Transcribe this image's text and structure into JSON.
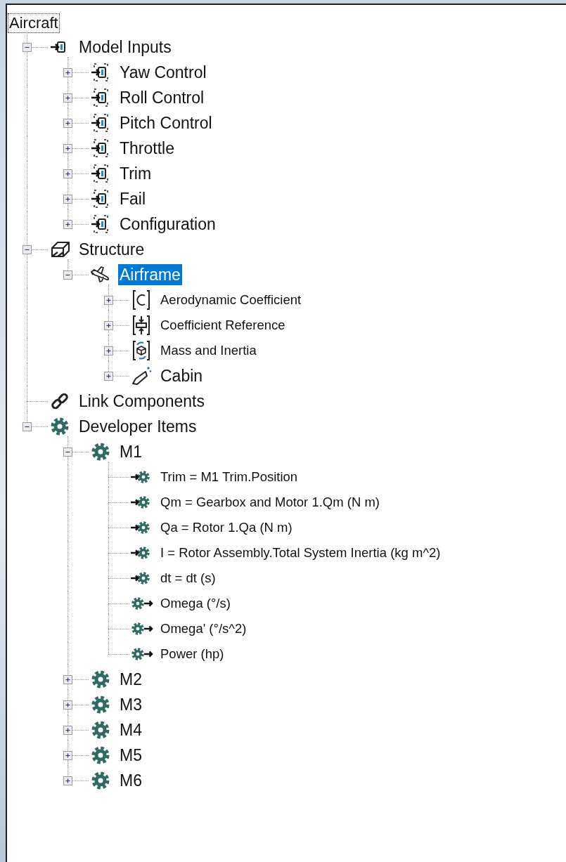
{
  "root": {
    "label": "Aircraft"
  },
  "items": [
    {
      "label": "Model Inputs",
      "kind": "input",
      "expanded": true,
      "selected": false,
      "children": [
        {
          "label": "Yaw Control",
          "kind": "input-dashed",
          "expanded": false,
          "selected": false
        },
        {
          "label": "Roll Control",
          "kind": "input-dashed",
          "expanded": false,
          "selected": false
        },
        {
          "label": "Pitch Control",
          "kind": "input-dashed",
          "expanded": false,
          "selected": false
        },
        {
          "label": "Throttle",
          "kind": "input-dashed",
          "expanded": false,
          "selected": false
        },
        {
          "label": "Trim",
          "kind": "input-dashed",
          "expanded": false,
          "selected": false
        },
        {
          "label": "Fail",
          "kind": "input-dashed",
          "expanded": false,
          "selected": false
        },
        {
          "label": "Configuration",
          "kind": "input-dashed",
          "expanded": false,
          "selected": false
        }
      ]
    },
    {
      "label": "Structure",
      "kind": "box",
      "expanded": true,
      "selected": false,
      "children": [
        {
          "label": "Airframe",
          "kind": "plane",
          "expanded": true,
          "selected": true,
          "children": [
            {
              "label": "Aerodynamic Coefficient",
              "kind": "coefficient",
              "expanded": false,
              "selected": false
            },
            {
              "label": "Coefficient Reference",
              "kind": "reference",
              "expanded": false,
              "selected": false
            },
            {
              "label": "Mass and Inertia",
              "kind": "mass",
              "expanded": false,
              "selected": false
            },
            {
              "label": "Cabin",
              "kind": "cabin",
              "expanded": false,
              "selected": false
            }
          ]
        }
      ]
    },
    {
      "label": "Link Components",
      "kind": "link",
      "selected": false
    },
    {
      "label": "Developer Items",
      "kind": "gear",
      "expanded": true,
      "selected": false,
      "children": [
        {
          "label": "M1",
          "kind": "gear",
          "expanded": true,
          "selected": false,
          "children": [
            {
              "label": "Trim = M1 Trim.Position",
              "kind": "gear-in",
              "selected": false
            },
            {
              "label": "Qm = Gearbox and Motor 1.Qm (N m)",
              "kind": "gear-in",
              "selected": false
            },
            {
              "label": "Qa = Rotor 1.Qa (N m)",
              "kind": "gear-in",
              "selected": false
            },
            {
              "label": "I = Rotor Assembly.Total System Inertia (kg m^2)",
              "kind": "gear-in",
              "selected": false
            },
            {
              "label": "dt = dt (s)",
              "kind": "gear-in",
              "selected": false
            },
            {
              "label": "Omega (°/s)",
              "kind": "gear-out",
              "selected": false
            },
            {
              "label": "Omega' (°/s^2)",
              "kind": "gear-out",
              "selected": false
            },
            {
              "label": "Power (hp)",
              "kind": "gear-out",
              "selected": false
            }
          ]
        },
        {
          "label": "M2",
          "kind": "gear",
          "expanded": false,
          "selected": false
        },
        {
          "label": "M3",
          "kind": "gear",
          "expanded": false,
          "selected": false
        },
        {
          "label": "M4",
          "kind": "gear",
          "expanded": false,
          "selected": false
        },
        {
          "label": "M5",
          "kind": "gear",
          "expanded": false,
          "selected": false
        },
        {
          "label": "M6",
          "kind": "gear",
          "expanded": false,
          "selected": false
        }
      ]
    }
  ]
}
